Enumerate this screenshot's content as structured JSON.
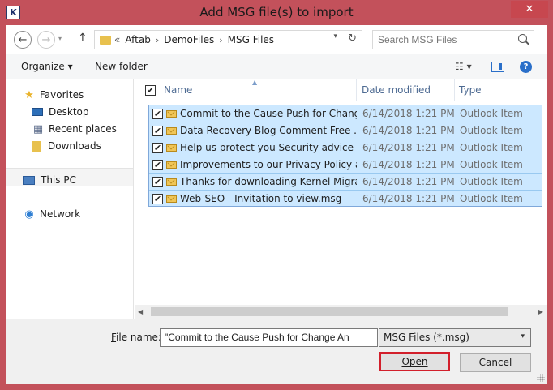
{
  "window": {
    "title": "Add MSG file(s) to import",
    "app_icon_letter": "K",
    "close_label": "✕",
    "colors": {
      "frame": "#c3515b",
      "selection": "#cce8ff",
      "selection_border": "#7fa8da",
      "open_highlight": "#d21f2b"
    }
  },
  "address": {
    "recent_glyph": "«",
    "segments": [
      "Aftab",
      "DemoFiles",
      "MSG Files"
    ],
    "separator": "›"
  },
  "search": {
    "placeholder": "Search MSG Files"
  },
  "toolbar": {
    "organize_label": "Organize ▾",
    "new_folder_label": "New folder",
    "view_label": "☷  ▾",
    "help_label": "?"
  },
  "navpane": {
    "favorites": "Favorites",
    "desktop": "Desktop",
    "recent_places": "Recent places",
    "downloads": "Downloads",
    "this_pc": "This PC",
    "network": "Network"
  },
  "columns": {
    "name": "Name",
    "date_modified": "Date modified",
    "type": "Type"
  },
  "files": [
    {
      "name": "Commit to the Cause  Push for Chang...",
      "date": "6/14/2018 1:21 PM",
      "type": "Outlook Item",
      "checked": true
    },
    {
      "name": "Data Recovery Blog  Comment   Free ...",
      "date": "6/14/2018 1:21 PM",
      "type": "Outlook Item",
      "checked": true
    },
    {
      "name": "Help us protect you  Security advice fr...",
      "date": "6/14/2018 1:21 PM",
      "type": "Outlook Item",
      "checked": true
    },
    {
      "name": "Improvements to our Privacy Policy a...",
      "date": "6/14/2018 1:21 PM",
      "type": "Outlook Item",
      "checked": true
    },
    {
      "name": "Thanks for downloading Kernel Migra...",
      "date": "6/14/2018 1:21 PM",
      "type": "Outlook Item",
      "checked": true
    },
    {
      "name": "Web-SEO - Invitation to view.msg",
      "date": "6/14/2018 1:21 PM",
      "type": "Outlook Item",
      "checked": true
    }
  ],
  "footer": {
    "file_name_label": "File name:",
    "file_name_value": "\"Commit to the Cause  Push for Change  An",
    "file_type_value": "MSG Files (*.msg)",
    "open_label": "Open",
    "cancel_label": "Cancel"
  }
}
